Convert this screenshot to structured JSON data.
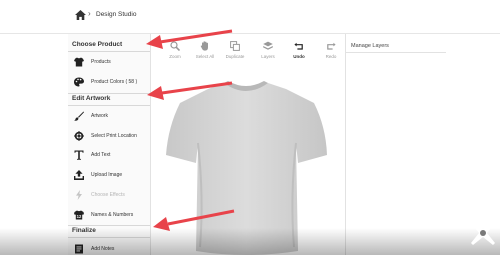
{
  "breadcrumb": {
    "separator": "›",
    "current": "Design Studio"
  },
  "sidebar": {
    "sections": [
      {
        "title": "Choose Product",
        "items": [
          {
            "label": "Products",
            "icon": "tshirt-icon",
            "enabled": true
          },
          {
            "label": "Product Colors  ( 58 )",
            "icon": "palette-icon",
            "enabled": true
          }
        ]
      },
      {
        "title": "Edit Artwork",
        "items": [
          {
            "label": "Artwork",
            "icon": "brush-icon",
            "enabled": true
          },
          {
            "label": "Select Print Location",
            "icon": "target-icon",
            "enabled": true
          },
          {
            "label": "Add Text",
            "icon": "text-icon",
            "enabled": true
          },
          {
            "label": "Upload Image",
            "icon": "upload-icon",
            "enabled": true
          },
          {
            "label": "Choose Effects",
            "icon": "effects-icon",
            "enabled": false
          },
          {
            "label": "Names & Numbers",
            "icon": "jersey-icon",
            "enabled": true
          }
        ]
      },
      {
        "title": "Finalize",
        "items": [
          {
            "label": "Add Notes",
            "icon": "notes-icon",
            "enabled": true
          }
        ]
      }
    ]
  },
  "toolbar": {
    "tools": [
      {
        "label": "Zoom",
        "icon": "zoom-icon",
        "active": false
      },
      {
        "label": "Select All",
        "icon": "hand-icon",
        "active": false
      },
      {
        "label": "Duplicate",
        "icon": "duplicate-icon",
        "active": false
      },
      {
        "label": "Layers",
        "icon": "layers-icon",
        "active": false
      },
      {
        "label": "Undo",
        "icon": "undo-icon",
        "active": true
      },
      {
        "label": "Redo",
        "icon": "redo-icon",
        "active": false
      }
    ]
  },
  "layers_panel": {
    "title": "Manage Layers"
  },
  "colors": {
    "arrow": "#e8434a",
    "shirt": "#d4d4d4",
    "accent": "#333333"
  }
}
